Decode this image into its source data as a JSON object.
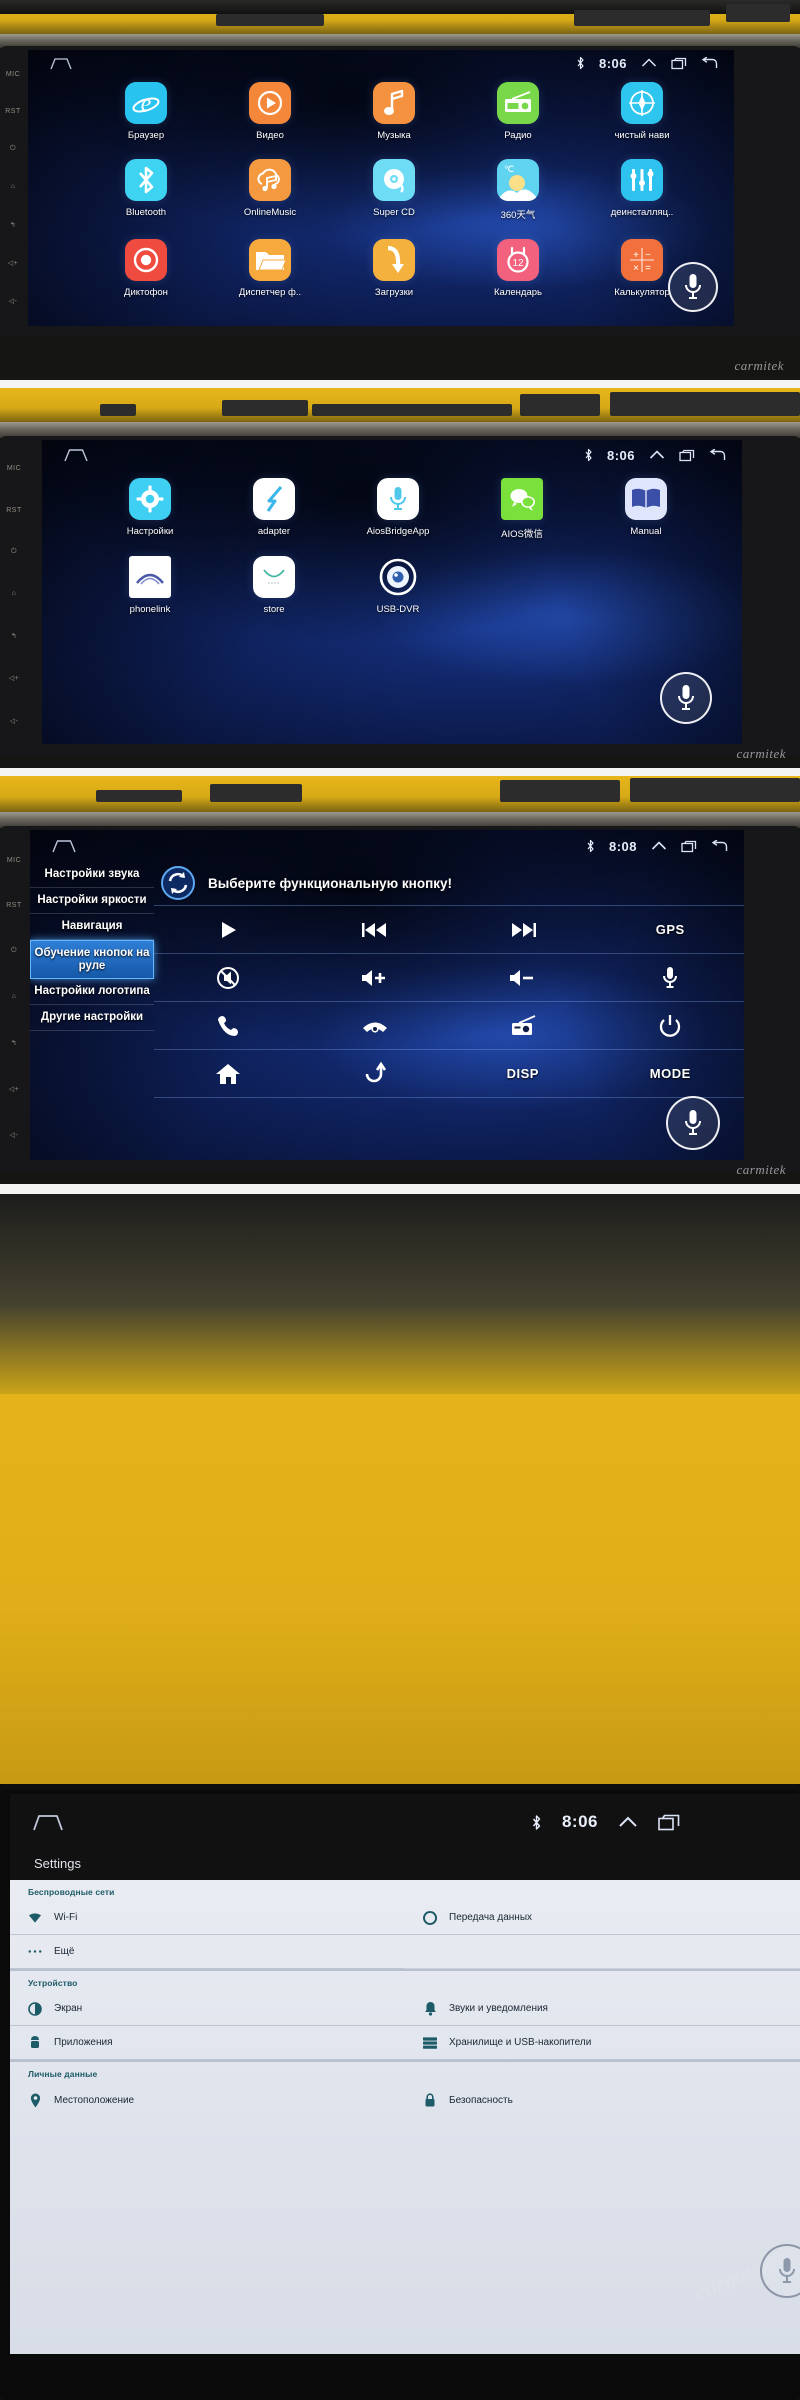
{
  "meta": {
    "watermark": "carmitek",
    "side_keys": [
      "MIC",
      "RST",
      "power-icon",
      "home-icon",
      "back-icon",
      "vol-up-icon",
      "vol-down-icon"
    ]
  },
  "panels": [
    {
      "id": "home-apps-page-1",
      "statusbar": {
        "home_icon": "home-icon",
        "bluetooth_icon": "bluetooth-icon",
        "time": "8:06",
        "up_icon": "chevron-up-icon",
        "recents_icon": "recents-icon",
        "back_icon": "back-icon"
      },
      "apps": [
        {
          "label": "Браузер",
          "icon": "internet-explorer-icon",
          "color": "#29c3f0"
        },
        {
          "label": "Видео",
          "icon": "play-circle-icon",
          "color": "#f4873a"
        },
        {
          "label": "Музыка",
          "icon": "music-note-icon",
          "color": "#f4923f"
        },
        {
          "label": "Радио",
          "icon": "radio-icon",
          "color": "#79d84a"
        },
        {
          "label": "чистый нави",
          "icon": "compass-icon",
          "color": "#2ec5ef"
        },
        {
          "label": "Bluetooth",
          "icon": "bluetooth-icon",
          "color": "#3fd3f2"
        },
        {
          "label": "OnlineMusic",
          "icon": "cloud-music-icon",
          "color": "#f4993f"
        },
        {
          "label": "Super CD",
          "icon": "disc-icon",
          "color": "#6ddcf4"
        },
        {
          "label": "360天气",
          "icon": "weather-icon",
          "color": "#5fd3f0"
        },
        {
          "label": "деинсталляц..",
          "icon": "uninstall-icon",
          "color": "#2ec2ef"
        },
        {
          "label": "Диктофон",
          "icon": "recorder-icon",
          "color": "#ef4b3e"
        },
        {
          "label": "Диспетчер ф..",
          "icon": "folder-icon",
          "color": "#f6a93c"
        },
        {
          "label": "Загрузки",
          "icon": "download-icon",
          "color": "#f5b13d"
        },
        {
          "label": "Календарь",
          "icon": "calendar-icon",
          "color": "#f2617e"
        },
        {
          "label": "Калькулятор",
          "icon": "calculator-icon",
          "color": "#f2703c"
        }
      ],
      "mic_button": "microphone-icon"
    },
    {
      "id": "home-apps-page-2",
      "statusbar": {
        "home_icon": "home-icon",
        "bluetooth_icon": "bluetooth-icon",
        "time": "8:06",
        "up_icon": "chevron-up-icon",
        "recents_icon": "recents-icon",
        "back_icon": "back-icon"
      },
      "apps": [
        {
          "label": "Настройки",
          "icon": "gear-icon",
          "color": "#3ecff2"
        },
        {
          "label": "adapter",
          "icon": "bolt-gauge-icon",
          "color": "#ffffff"
        },
        {
          "label": "AiosBridgeApp",
          "icon": "microphone-icon",
          "color": "#ffffff"
        },
        {
          "label": "AIOS微信",
          "icon": "wechat-icon",
          "color": "#7ae03c"
        },
        {
          "label": "Manual",
          "icon": "book-icon",
          "color": "#dfe6fb"
        },
        {
          "label": "phonelink",
          "icon": "phonelink-icon",
          "color": "#ffffff"
        },
        {
          "label": "store",
          "icon": "store-bag-icon",
          "color": "#ffffff"
        },
        {
          "label": "USB-DVR",
          "icon": "dvr-camera-icon",
          "color": "#eaf3ff"
        }
      ],
      "mic_button": "microphone-icon"
    },
    {
      "id": "steering-wheel-key-learning",
      "statusbar": {
        "home_icon": "home-icon",
        "bluetooth_icon": "bluetooth-icon",
        "time": "8:08",
        "up_icon": "chevron-up-icon",
        "recents_icon": "recents-icon",
        "back_icon": "back-icon"
      },
      "menu": [
        {
          "label": "Настройки звука",
          "selected": false
        },
        {
          "label": "Настройки яркости",
          "selected": false
        },
        {
          "label": "Навигация",
          "selected": false
        },
        {
          "label": "Обучение кнопок на руле",
          "selected": true
        },
        {
          "label": "Настройки логотипа",
          "selected": false
        },
        {
          "label": "Другие настройки",
          "selected": false
        }
      ],
      "dialog": {
        "refresh_icon": "refresh-circle-icon",
        "title": "Выберите функциональную кнопку!"
      },
      "functions": [
        {
          "icon": "play-icon",
          "text": ""
        },
        {
          "icon": "prev-track-icon",
          "text": ""
        },
        {
          "icon": "next-track-icon",
          "text": ""
        },
        {
          "icon": "gps-label",
          "text": "GPS"
        },
        {
          "icon": "mute-icon",
          "text": ""
        },
        {
          "icon": "volume-up-icon",
          "text": ""
        },
        {
          "icon": "volume-down-icon",
          "text": ""
        },
        {
          "icon": "microphone-icon",
          "text": ""
        },
        {
          "icon": "phone-call-icon",
          "text": ""
        },
        {
          "icon": "phone-hangup-icon",
          "text": ""
        },
        {
          "icon": "radio-icon",
          "text": ""
        },
        {
          "icon": "power-icon",
          "text": ""
        },
        {
          "icon": "home-icon",
          "text": ""
        },
        {
          "icon": "back-arrow-icon",
          "text": ""
        },
        {
          "icon": "disp-label",
          "text": "DISP"
        },
        {
          "icon": "mode-label",
          "text": "MODE"
        }
      ],
      "mic_button": "microphone-icon"
    },
    {
      "id": "android-settings",
      "statusbar": {
        "home_icon": "home-icon",
        "bluetooth_icon": "bluetooth-icon",
        "time": "8:06",
        "up_icon": "chevron-up-icon",
        "recents_icon": "recents-icon"
      },
      "title": "Settings",
      "sections": [
        {
          "header": "Беспроводные сети",
          "rows": [
            {
              "label": "Wi-Fi",
              "icon": "wifi-icon"
            },
            {
              "label": "Передача данных",
              "icon": "data-usage-icon"
            },
            {
              "label": "Ещё",
              "icon": "more-dots-icon"
            },
            {
              "label": "",
              "icon": ""
            }
          ]
        },
        {
          "header": "Устройство",
          "rows": [
            {
              "label": "Экран",
              "icon": "display-icon"
            },
            {
              "label": "Звуки и уведомления",
              "icon": "bell-icon"
            },
            {
              "label": "Приложения",
              "icon": "android-icon"
            },
            {
              "label": "Хранилище и USB-накопители",
              "icon": "storage-icon"
            }
          ]
        },
        {
          "header": "Личные данные",
          "rows": [
            {
              "label": "Местоположение",
              "icon": "location-pin-icon"
            },
            {
              "label": "Безопасность",
              "icon": "lock-icon"
            }
          ]
        }
      ],
      "mic_button": "microphone-icon"
    }
  ]
}
